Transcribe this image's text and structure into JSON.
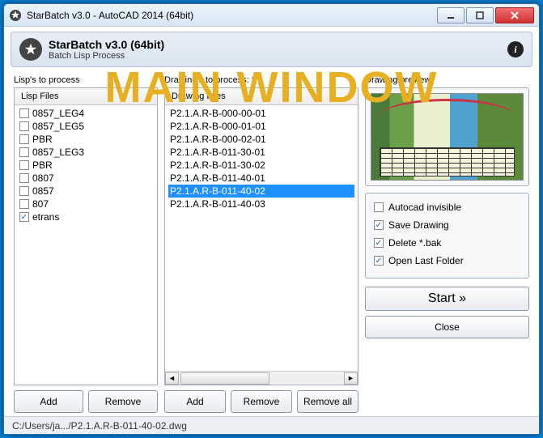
{
  "window": {
    "title": "StarBatch v3.0 - AutoCAD 2014 (64bit)"
  },
  "header": {
    "title": "StarBatch v3.0 (64bit)",
    "subtitle": "Batch Lisp Process"
  },
  "overlay": {
    "text": "MAIN WINDOW"
  },
  "lisps": {
    "label": "Lisp's to process",
    "column": "Lisp Files",
    "items": [
      {
        "label": "0857_LEG4",
        "checked": false
      },
      {
        "label": "0857_LEG5",
        "checked": false
      },
      {
        "label": "PBR",
        "checked": false
      },
      {
        "label": "0857_LEG3",
        "checked": false
      },
      {
        "label": "PBR",
        "checked": false
      },
      {
        "label": "0807",
        "checked": false
      },
      {
        "label": "0857",
        "checked": false
      },
      {
        "label": "807",
        "checked": false
      },
      {
        "label": "etrans",
        "checked": true
      }
    ]
  },
  "drawings": {
    "label": "Drawing's to process: 8",
    "column": "Drawing Files",
    "items": [
      {
        "label": "P2.1.A.R-B-000-00-01",
        "selected": false
      },
      {
        "label": "P2.1.A.R-B-000-01-01",
        "selected": false
      },
      {
        "label": "P2.1.A.R-B-000-02-01",
        "selected": false
      },
      {
        "label": "P2.1.A.R-B-011-30-01",
        "selected": false
      },
      {
        "label": "P2.1.A.R-B-011-30-02",
        "selected": false
      },
      {
        "label": "P2.1.A.R-B-011-40-01",
        "selected": false
      },
      {
        "label": "P2.1.A.R-B-011-40-02",
        "selected": true
      },
      {
        "label": "P2.1.A.R-B-011-40-03",
        "selected": false
      }
    ]
  },
  "preview": {
    "label": "Drawing preview"
  },
  "options": {
    "items": [
      {
        "label": "Autocad invisible",
        "checked": false
      },
      {
        "label": "Save Drawing",
        "checked": true
      },
      {
        "label": "Delete *.bak",
        "checked": true
      },
      {
        "label": "Open Last Folder",
        "checked": true
      }
    ]
  },
  "buttons": {
    "add": "Add",
    "remove": "Remove",
    "remove_all": "Remove all",
    "start": "Start »",
    "close": "Close"
  },
  "status": {
    "text": "C:/Users/ja.../P2.1.A.R-B-011-40-02.dwg"
  }
}
